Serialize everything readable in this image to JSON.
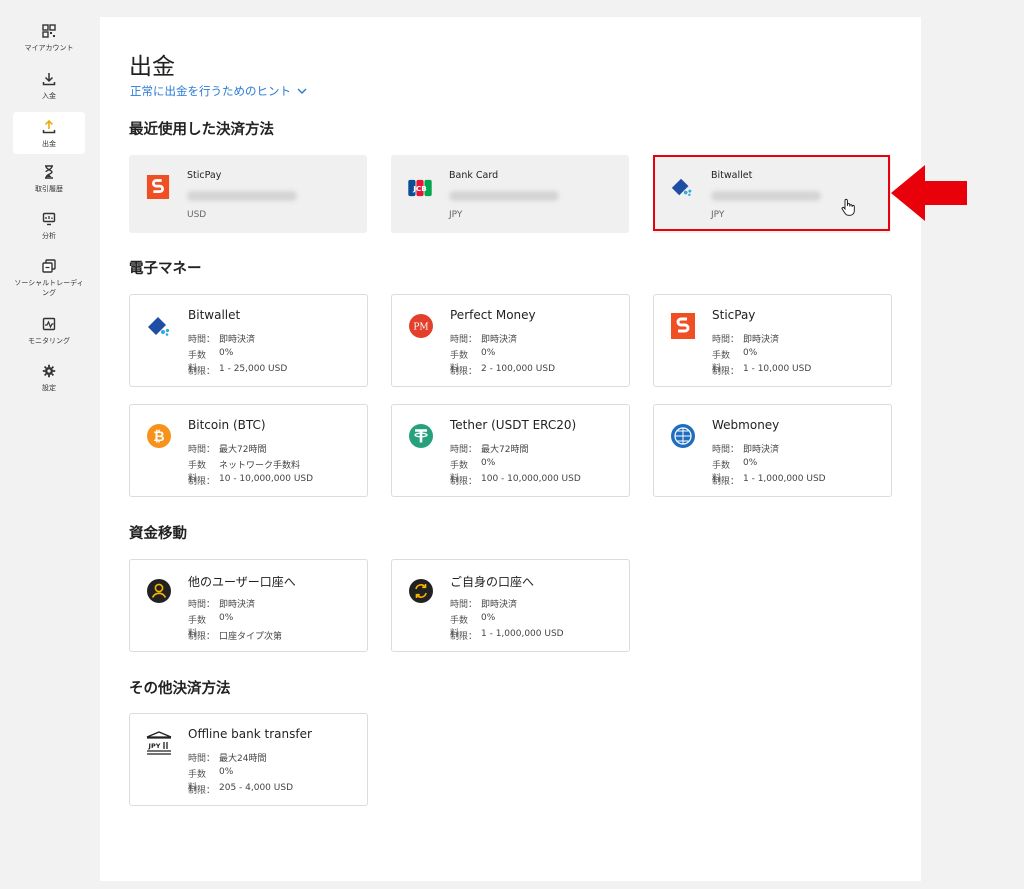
{
  "sidebar": {
    "items": [
      {
        "label": "マイアカウント",
        "icon": "dashboard-icon"
      },
      {
        "label": "入金",
        "icon": "deposit-icon"
      },
      {
        "label": "出金",
        "icon": "withdraw-icon",
        "active": true
      },
      {
        "label": "取引履歴",
        "icon": "hourglass-icon"
      },
      {
        "label": "分析",
        "icon": "analytics-icon"
      },
      {
        "label": "ソーシャルトレーディング",
        "icon": "social-trading-icon"
      },
      {
        "label": "モニタリング",
        "icon": "monitoring-icon"
      },
      {
        "label": "設定",
        "icon": "gear-icon"
      }
    ]
  },
  "page": {
    "title": "出金",
    "hint_link": "正常に出金を行うためのヒント"
  },
  "sections": {
    "recent": "最近使用した決済方法",
    "emoney": "電子マネー",
    "transfer": "資金移動",
    "other": "その他決済方法"
  },
  "labels": {
    "time": "時間：",
    "fee": "手数料:",
    "limit": "制限："
  },
  "recent": [
    {
      "name": "SticPay",
      "currency": "USD",
      "icon": "sticpay-icon"
    },
    {
      "name": "Bank Card",
      "currency": "JPY",
      "icon": "jcb-icon"
    },
    {
      "name": "Bitwallet",
      "currency": "JPY",
      "icon": "bitwallet-icon"
    }
  ],
  "emoney": [
    {
      "name": "Bitwallet",
      "time": "即時決済",
      "fee": "0%",
      "limit": "1 - 25,000 USD",
      "icon": "bitwallet-icon"
    },
    {
      "name": "Perfect Money",
      "time": "即時決済",
      "fee": "0%",
      "limit": "2 - 100,000 USD",
      "icon": "perfect-money-icon"
    },
    {
      "name": "SticPay",
      "time": "即時決済",
      "fee": "0%",
      "limit": "1 - 10,000 USD",
      "icon": "sticpay-icon"
    },
    {
      "name": "Bitcoin (BTC)",
      "time": "最大72時間",
      "fee": "ネットワーク手数料",
      "limit": "10 - 10,000,000 USD",
      "icon": "bitcoin-icon"
    },
    {
      "name": "Tether (USDT ERC20)",
      "time": "最大72時間",
      "fee": "0%",
      "limit": "100 - 10,000,000 USD",
      "icon": "tether-icon"
    },
    {
      "name": "Webmoney",
      "time": "即時決済",
      "fee": "0%",
      "limit": "1 - 1,000,000 USD",
      "icon": "webmoney-icon"
    }
  ],
  "transfer": [
    {
      "name": "他のユーザー口座へ",
      "time": "即時決済",
      "fee": "0%",
      "limit": "口座タイプ次第",
      "icon": "user-icon"
    },
    {
      "name": "ご自身の口座へ",
      "time": "即時決済",
      "fee": "0%",
      "limit": "1 - 1,000,000 USD",
      "icon": "exchange-icon"
    }
  ],
  "other": [
    {
      "name": "Offline bank transfer",
      "time": "最大24時間",
      "fee": "0%",
      "limit": "205 - 4,000 USD",
      "icon": "bank-icon",
      "icon_text": "JPY"
    }
  ],
  "colors": {
    "link": "#2a7bd3",
    "highlight": "#e8000b",
    "sticpay": "#f04e23",
    "bitwallet": "#1f4fa5",
    "bitcoin": "#f7931a",
    "tether": "#26a17b"
  }
}
